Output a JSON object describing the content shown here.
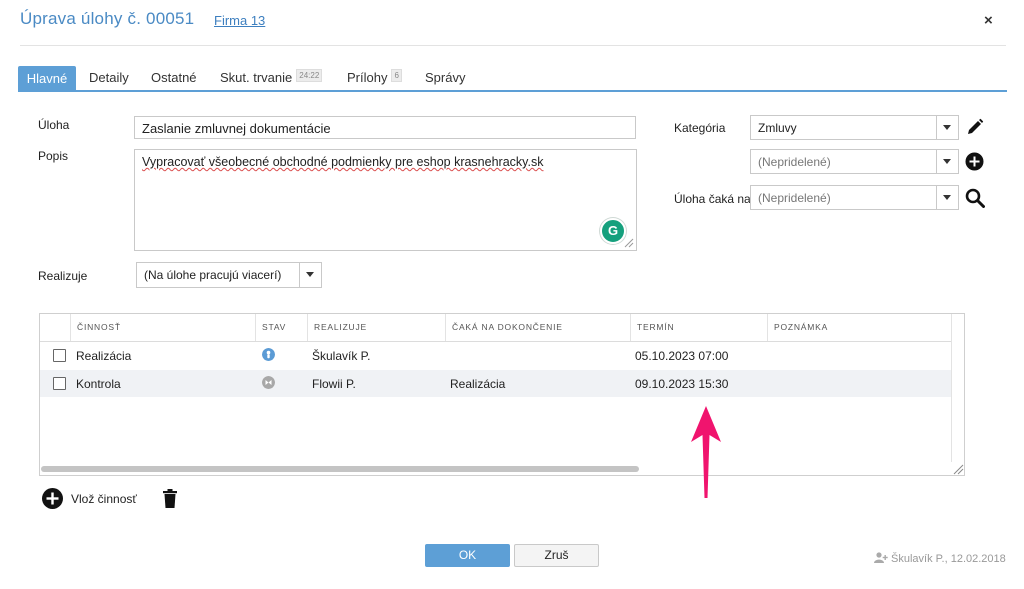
{
  "header": {
    "title": "Úprava úlohy č. 00051",
    "company_link": "Firma 13",
    "close": "×"
  },
  "tabs": [
    {
      "label": "Hlavné",
      "active": true
    },
    {
      "label": "Detaily"
    },
    {
      "label": "Ostatné"
    },
    {
      "label": "Skut. trvanie",
      "badge": "24:22"
    },
    {
      "label": "Prílohy",
      "badge": "6"
    },
    {
      "label": "Správy"
    }
  ],
  "form": {
    "task_label": "Úloha",
    "task_value": "Zaslanie zmluvnej dokumentácie",
    "description_label": "Popis",
    "description_value": "Vypracovať všeobecné obchodné podmienky pre eshop krasnehracky.sk",
    "category_label": "Kategória",
    "category_value": "Zmluvy",
    "subcategory_value": "(Nepridelené)",
    "waits_for_label": "Úloha čaká na",
    "waits_for_value": "(Nepridelené)",
    "realizes_label": "Realizuje",
    "realizes_value": "(Na úlohe pracujú viacerí)"
  },
  "activities": {
    "columns": [
      "ČINNOSŤ",
      "STAV",
      "REALIZUJE",
      "ČAKÁ NA DOKONČENIE",
      "TERMÍN",
      "POZNÁMKA"
    ],
    "rows": [
      {
        "activity": "Realizácia",
        "status": "in-progress",
        "assignee": "Škulavík P.",
        "waits_for": "",
        "deadline": "05.10.2023 07:00",
        "note": ""
      },
      {
        "activity": "Kontrola",
        "status": "waiting",
        "assignee": "Flowii P.",
        "waits_for": "Realizácia",
        "deadline": "09.10.2023 15:30",
        "note": ""
      }
    ]
  },
  "actions": {
    "add_activity": "Vlož činnosť",
    "ok": "OK",
    "cancel": "Zruš"
  },
  "footer": {
    "author": "Škulavík P., 12.02.2018"
  },
  "colors": {
    "accent": "#5d9fd6",
    "status_in_progress": "#5b9bd5",
    "status_waiting": "#a8a8a8",
    "annotation_arrow": "#f0146e"
  },
  "icons": {
    "close": "close-icon",
    "edit": "pencil-icon",
    "add": "plus-circle-icon",
    "search": "search-icon",
    "grammarly": "grammarly-icon",
    "delete": "trash-icon",
    "author": "user-add-icon",
    "annotation": "arrow-up-icon"
  }
}
